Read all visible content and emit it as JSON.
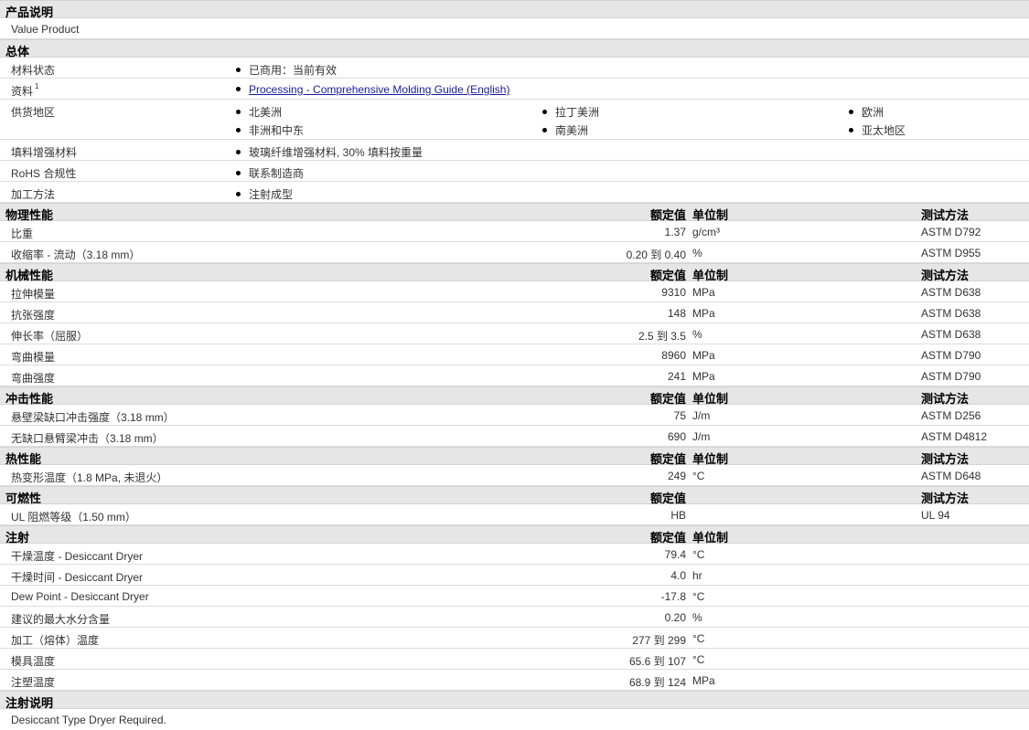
{
  "product_desc": {
    "header": "产品说明",
    "text": "Value Product"
  },
  "general": {
    "header": "总体",
    "rows": [
      {
        "label": "材料状态",
        "items": [
          "已商用：当前有效"
        ]
      },
      {
        "label": "资料",
        "sup": "1",
        "items": [
          "Processing - Comprehensive Molding Guide (English)"
        ]
      },
      {
        "label": "供货地区",
        "items": [
          "北美洲",
          "拉丁美洲",
          "欧洲",
          "非洲和中东",
          "南美洲",
          "亚太地区"
        ]
      },
      {
        "label": "填料增强材料",
        "items": [
          "玻璃纤维增强材料, 30% 填料按重量"
        ]
      },
      {
        "label": "RoHS 合规性",
        "items": [
          "联系制造商"
        ]
      },
      {
        "label": "加工方法",
        "items": [
          "注射成型"
        ]
      }
    ]
  },
  "col_headers": {
    "nominal": "额定值",
    "unit": "单位制",
    "method": "测试方法"
  },
  "physical": {
    "header": "物理性能",
    "rows": [
      {
        "label": "比重",
        "value": "1.37",
        "unit": "g/cm³",
        "method": "ASTM D792"
      },
      {
        "label": "收缩率 - 流动（3.18 mm）",
        "value": "0.20 到  0.40",
        "unit": "%",
        "method": "ASTM D955"
      }
    ]
  },
  "mechanical": {
    "header": "机械性能",
    "rows": [
      {
        "label": "拉伸模量",
        "value": "9310",
        "unit": "MPa",
        "method": "ASTM D638"
      },
      {
        "label": "抗张强度",
        "value": "148",
        "unit": "MPa",
        "method": "ASTM D638"
      },
      {
        "label": "伸长率（屈服）",
        "value": "2.5 到  3.5",
        "unit": "%",
        "method": "ASTM D638"
      },
      {
        "label": "弯曲模量",
        "value": "8960",
        "unit": "MPa",
        "method": "ASTM D790"
      },
      {
        "label": "弯曲强度",
        "value": "241",
        "unit": "MPa",
        "method": "ASTM D790"
      }
    ]
  },
  "impact": {
    "header": "冲击性能",
    "rows": [
      {
        "label": "悬壁梁缺口冲击强度（3.18 mm）",
        "value": "75",
        "unit": "J/m",
        "method": "ASTM D256"
      },
      {
        "label": "无缺口悬臂梁冲击（3.18 mm）",
        "value": "690",
        "unit": "J/m",
        "method": "ASTM D4812"
      }
    ]
  },
  "thermal": {
    "header": "热性能",
    "rows": [
      {
        "label": "热变形温度（1.8 MPa, 未退火）",
        "value": "249",
        "unit": "°C",
        "method": "ASTM D648"
      }
    ]
  },
  "flammability": {
    "header": "可燃性",
    "rows": [
      {
        "label": "UL 阻燃等级（1.50 mm）",
        "value": "HB",
        "unit": "",
        "method": "UL 94"
      }
    ]
  },
  "injection": {
    "header": "注射",
    "rows": [
      {
        "label": "干燥温度 - Desiccant Dryer",
        "value": "79.4",
        "unit": "°C"
      },
      {
        "label": "干燥时间 - Desiccant Dryer",
        "value": "4.0",
        "unit": "hr"
      },
      {
        "label": "Dew Point - Desiccant Dryer",
        "value": "-17.8",
        "unit": "°C"
      },
      {
        "label": "建议的最大水分含量",
        "value": "0.20",
        "unit": "%"
      },
      {
        "label": "加工（熔体）温度",
        "value": "277 到  299",
        "unit": "°C"
      },
      {
        "label": "模具温度",
        "value": "65.6 到  107",
        "unit": "°C"
      },
      {
        "label": "注塑温度",
        "value": "68.9 到  124",
        "unit": "MPa"
      }
    ]
  },
  "injection_notes": {
    "header": "注射说明",
    "text": "Desiccant Type Dryer Required."
  }
}
